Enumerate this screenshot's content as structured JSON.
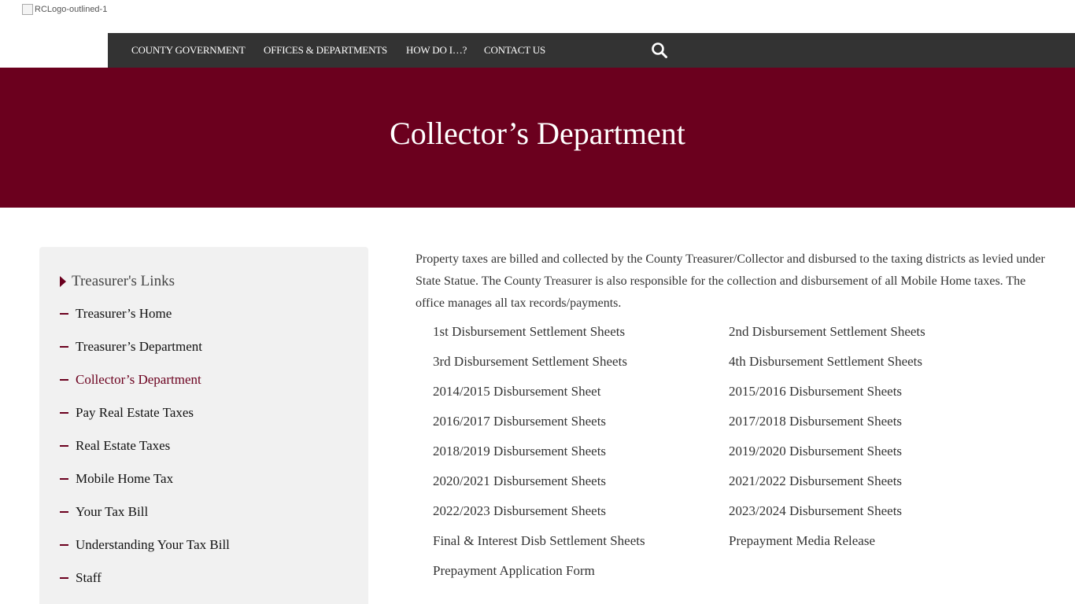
{
  "header": {
    "logo_alt": "RCLogo-outlined-1"
  },
  "nav": {
    "items": [
      {
        "label": "COUNTY GOVERNMENT"
      },
      {
        "label": "OFFICES & DEPARTMENTS"
      },
      {
        "label": "HOW DO I…?"
      },
      {
        "label": "CONTACT US"
      }
    ],
    "search_icon": "search-icon"
  },
  "banner": {
    "title": "Collector’s Department"
  },
  "sidebar": {
    "heading": "Treasurer's Links",
    "items": [
      {
        "label": "Treasurer’s Home"
      },
      {
        "label": "Treasurer’s Department"
      },
      {
        "label": "Collector’s Department"
      },
      {
        "label": "Pay Real Estate Taxes"
      },
      {
        "label": "Real Estate Taxes"
      },
      {
        "label": "Mobile Home Tax"
      },
      {
        "label": "Your Tax Bill"
      },
      {
        "label": "Understanding Your Tax Bill"
      },
      {
        "label": "Staff"
      }
    ]
  },
  "main": {
    "intro": "Property taxes are billed and collected by the County Treasurer/Collector and disbursed to the taxing districts as levied under State Statue. The County Treasurer is also responsible for the collection and disbursement of all Mobile Home taxes. The office manages all tax records/payments.",
    "links": [
      {
        "label": "1st Disbursement Settlement Sheets"
      },
      {
        "label": "2nd Disbursement Settlement Sheets"
      },
      {
        "label": "3rd Disbursement Settlement Sheets"
      },
      {
        "label": "4th Disbursement Settlement Sheets"
      },
      {
        "label": "2014/2015 Disbursement Sheet"
      },
      {
        "label": "2015/2016 Disbursement Sheets"
      },
      {
        "label": "2016/2017 Disbursement Sheets"
      },
      {
        "label": "2017/2018 Disbursement Sheets"
      },
      {
        "label": "2018/2019 Disbursement Sheets"
      },
      {
        "label": "2019/2020 Disbursement Sheets"
      },
      {
        "label": "2020/2021 Disbursement Sheets"
      },
      {
        "label": "2021/2022 Disbursement Sheets"
      },
      {
        "label": "2022/2023 Disbursement Sheets"
      },
      {
        "label": "2023/2024 Disbursement Sheets"
      },
      {
        "label": "Final & Interest Disb Settlement Sheets"
      },
      {
        "label": "Prepayment Media Release"
      },
      {
        "label": "Prepayment Application Form"
      }
    ]
  },
  "colors": {
    "brand": "#6b001e",
    "nav_bg": "#333333",
    "sidebar_bg": "#f1f1f1"
  }
}
